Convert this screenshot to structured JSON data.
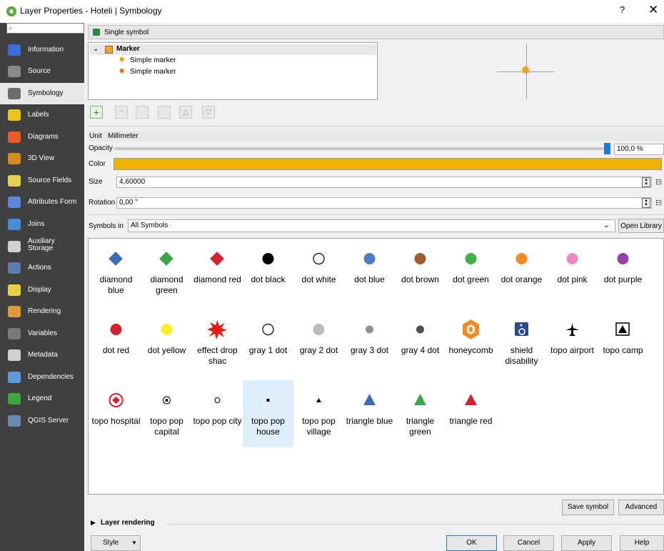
{
  "window": {
    "title": "Layer Properties - Hoteli | Symbology",
    "help": "?",
    "close": "✕"
  },
  "sidebar": {
    "search_value": "",
    "items": [
      {
        "label": "Information",
        "color": "#3a6fd8"
      },
      {
        "label": "Source",
        "color": "#8a8a8a"
      },
      {
        "label": "Symbology",
        "color": "#6b6b6b"
      },
      {
        "label": "Labels",
        "color": "#e8c51a"
      },
      {
        "label": "Diagrams",
        "color": "#e85a2a"
      },
      {
        "label": "3D View",
        "color": "#d88a1a"
      },
      {
        "label": "Source Fields",
        "color": "#e8d050"
      },
      {
        "label": "Attributes Form",
        "color": "#5a8ad8"
      },
      {
        "label": "Joins",
        "color": "#4a8ad8"
      },
      {
        "label": "Auxiliary Storage",
        "color": "#d0d0d0"
      },
      {
        "label": "Actions",
        "color": "#5a7ab0"
      },
      {
        "label": "Display",
        "color": "#e8d040"
      },
      {
        "label": "Rendering",
        "color": "#d89a3a"
      },
      {
        "label": "Variables",
        "color": "#7a7a7a"
      },
      {
        "label": "Metadata",
        "color": "#d0d0d0"
      },
      {
        "label": "Dependencies",
        "color": "#5a9ad8"
      },
      {
        "label": "Legend",
        "color": "#3aa83a"
      },
      {
        "label": "QGIS Server",
        "color": "#6a8ab0"
      }
    ]
  },
  "renderer": {
    "type": "Single symbol"
  },
  "layers_tree": {
    "root": "Marker",
    "children": [
      "Simple marker",
      "Simple marker"
    ]
  },
  "properties": {
    "unit_label": "Unit",
    "unit_value": "Millimeter",
    "opacity_label": "Opacity",
    "opacity_value": "100,0 %",
    "opacity_level": 1.0,
    "color_label": "Color",
    "color_value": "#f0b400",
    "size_label": "Size",
    "size_value": "4,60000",
    "rotation_label": "Rotation",
    "rotation_value": "0,00 °"
  },
  "library": {
    "symbols_in_label": "Symbols in",
    "symbols_in_value": "All Symbols",
    "open_library": "Open Library"
  },
  "symbols": [
    {
      "name": "diamond blue",
      "shape": "diamond",
      "color": "#3b6cb4"
    },
    {
      "name": "diamond green",
      "shape": "diamond",
      "color": "#3fa54a"
    },
    {
      "name": "diamond red",
      "shape": "diamond",
      "color": "#d42030"
    },
    {
      "name": "dot black",
      "shape": "dot",
      "color": "#000000"
    },
    {
      "name": "dot white",
      "shape": "dot-outline",
      "color": "#ffffff"
    },
    {
      "name": "dot blue",
      "shape": "dot",
      "color": "#4d7cc8"
    },
    {
      "name": "dot brown",
      "shape": "dot",
      "color": "#a05a2c"
    },
    {
      "name": "dot green",
      "shape": "dot",
      "color": "#44b24a"
    },
    {
      "name": "dot orange",
      "shape": "dot",
      "color": "#f08c28"
    },
    {
      "name": "dot pink",
      "shape": "dot",
      "color": "#f088c8"
    },
    {
      "name": "dot purple",
      "shape": "dot",
      "color": "#9640a8"
    },
    {
      "name": "dot red",
      "shape": "dot",
      "color": "#d4202e"
    },
    {
      "name": "dot yellow",
      "shape": "dot",
      "color": "#f8f028"
    },
    {
      "name": "effect drop shac",
      "shape": "star",
      "color": "#e81818"
    },
    {
      "name": "gray 1 dot",
      "shape": "dot-outline",
      "color": "#ffffff"
    },
    {
      "name": "gray 2 dot",
      "shape": "dot",
      "color": "#bcbcbc"
    },
    {
      "name": "gray 3 dot",
      "shape": "dot-small",
      "color": "#909090"
    },
    {
      "name": "gray 4 dot",
      "shape": "dot-small",
      "color": "#505050"
    },
    {
      "name": "honeycomb",
      "shape": "hexagon",
      "color": "#f08c28"
    },
    {
      "name": "shield disability",
      "shape": "wheelchair",
      "color": "#2a4a8a"
    },
    {
      "name": "topo airport",
      "shape": "airplane",
      "color": "#000000"
    },
    {
      "name": "topo camp",
      "shape": "camp",
      "color": "#000000"
    },
    {
      "name": "topo hospital",
      "shape": "hospital",
      "color": "#d4202e"
    },
    {
      "name": "topo pop capital",
      "shape": "capital",
      "color": "#000000"
    },
    {
      "name": "topo pop city",
      "shape": "city",
      "color": "#000000"
    },
    {
      "name": "topo pop house",
      "shape": "square",
      "color": "#000000",
      "selected": true
    },
    {
      "name": "topo pop village",
      "shape": "triangle-small",
      "color": "#000000"
    },
    {
      "name": "triangle blue",
      "shape": "triangle",
      "color": "#3b6cb4"
    },
    {
      "name": "triangle green",
      "shape": "triangle",
      "color": "#3fa54a"
    },
    {
      "name": "triangle red",
      "shape": "triangle",
      "color": "#d42030"
    }
  ],
  "buttons": {
    "save_symbol": "Save symbol",
    "advanced": "Advanced",
    "layer_rendering": "Layer rendering",
    "style": "Style",
    "ok": "OK",
    "cancel": "Cancel",
    "apply": "Apply",
    "help": "Help"
  }
}
